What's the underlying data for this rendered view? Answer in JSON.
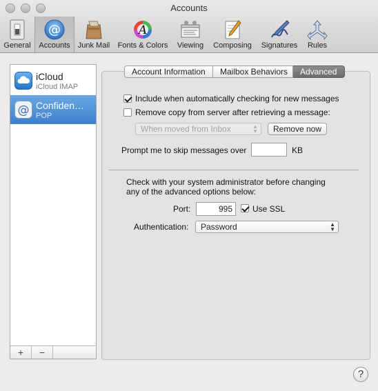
{
  "window": {
    "title": "Accounts"
  },
  "toolbar": {
    "items": [
      {
        "label": "General",
        "icon": "general-switch-icon"
      },
      {
        "label": "Accounts",
        "icon": "at-sign-icon",
        "selected": true
      },
      {
        "label": "Junk Mail",
        "icon": "junk-mail-icon"
      },
      {
        "label": "Fonts & Colors",
        "icon": "fonts-colors-icon"
      },
      {
        "label": "Viewing",
        "icon": "viewing-icon"
      },
      {
        "label": "Composing",
        "icon": "composing-icon"
      },
      {
        "label": "Signatures",
        "icon": "signatures-icon"
      },
      {
        "label": "Rules",
        "icon": "rules-icon"
      }
    ]
  },
  "sidebar": {
    "accounts": [
      {
        "name": "iCloud",
        "type": "iCloud IMAP",
        "icon": "icloud-icon"
      },
      {
        "name": "Confiden…",
        "type": "POP",
        "icon": "at-sign-icon",
        "selected": true
      }
    ],
    "add_label": "+",
    "remove_label": "−"
  },
  "tabs": [
    {
      "label": "Account Information"
    },
    {
      "label": "Mailbox Behaviors"
    },
    {
      "label": "Advanced",
      "active": true
    }
  ],
  "advanced": {
    "include_check_label": "Include when automatically checking for new messages",
    "include_checked": true,
    "remove_copy_label": "Remove copy from server after retrieving a message:",
    "remove_copy_checked": false,
    "remove_when_value": "When moved from Inbox",
    "remove_now_label": "Remove now",
    "prompt_skip_label": "Prompt me to skip messages over",
    "prompt_skip_value": "",
    "kb_label": "KB",
    "admin_note_line1": "Check with your system administrator before changing",
    "admin_note_line2": "any of the advanced options below:",
    "port_label": "Port:",
    "port_value": "995",
    "use_ssl_label": "Use SSL",
    "use_ssl_checked": true,
    "auth_label": "Authentication:",
    "auth_value": "Password"
  },
  "help_label": "?"
}
